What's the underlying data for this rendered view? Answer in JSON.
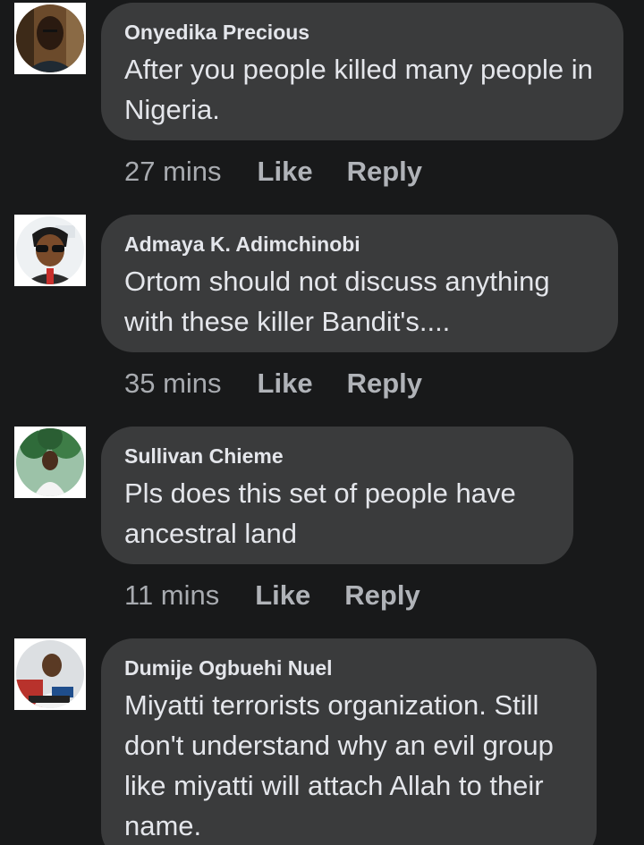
{
  "comments": [
    {
      "author": "Onyedika Precious",
      "text": "After you people killed many people in Nigeria.",
      "time": "27 mins",
      "like_label": "Like",
      "reply_label": "Reply"
    },
    {
      "author": "Admaya K. Adimchinobi",
      "text": "Ortom should not discuss anything with these killer Bandit's....",
      "time": "35 mins",
      "like_label": "Like",
      "reply_label": "Reply"
    },
    {
      "author": "Sullivan Chieme",
      "text": "Pls does this set of people have ancestral land",
      "time": "11 mins",
      "like_label": "Like",
      "reply_label": "Reply"
    },
    {
      "author": "Dumije Ogbuehi Nuel",
      "text": "Miyatti terrorists organization. Still don't understand why an evil group like miyatti will attach Allah to their name."
    }
  ],
  "colors": {
    "background": "#18191a",
    "bubble": "#3a3b3c",
    "text": "#e4e6eb",
    "muted": "#b0b3b8"
  }
}
